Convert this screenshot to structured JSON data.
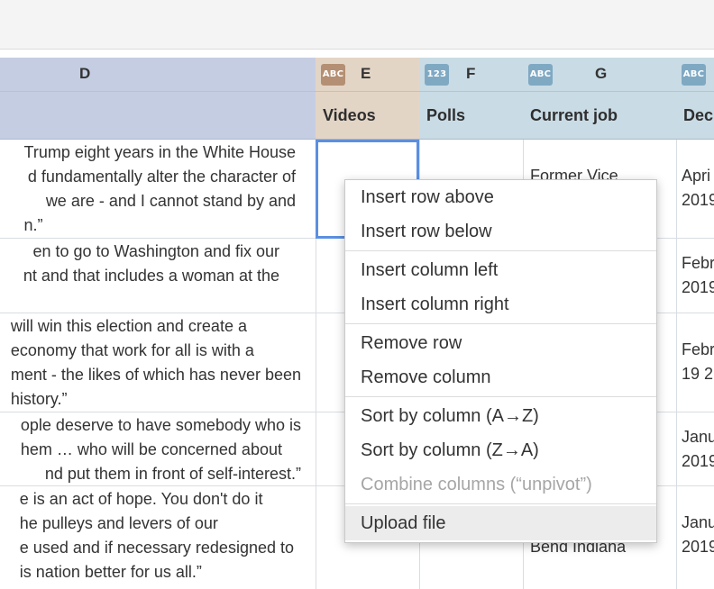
{
  "columns": {
    "D": {
      "letter": "D",
      "name": ""
    },
    "E": {
      "letter": "E",
      "name": "Videos",
      "type": "ABC"
    },
    "F": {
      "letter": "F",
      "name": "Polls",
      "type": "123"
    },
    "G": {
      "letter": "G",
      "name": "Current job",
      "type": "ABC"
    },
    "H": {
      "letter": "",
      "name": "Dec",
      "type": "ABC"
    }
  },
  "rows": [
    {
      "quote": [
        "Trump eight years in the White House",
        "d fundamentally alter the character of",
        "we are - and I cannot stand by and",
        "n.”"
      ],
      "job": "Former Vice",
      "date": [
        "Apri",
        "2019"
      ]
    },
    {
      "quote": [
        "en to go to Washington and fix our",
        "nt and that includes a woman at the"
      ],
      "job": "",
      "date": [
        "Febr",
        "2019"
      ]
    },
    {
      "quote": [
        "will win this election and create a",
        "economy that work for all is with a",
        "ment - the likes of which has never been",
        "history.”"
      ],
      "job": "",
      "date": [
        "Febr",
        "19 2"
      ]
    },
    {
      "quote": [
        "ople deserve to have somebody who is",
        "hem … who will be concerned about",
        "nd put them in front of self-interest.”"
      ],
      "job": "",
      "date": [
        "Janu",
        "2019"
      ]
    },
    {
      "quote": [
        "e is an act of hope. You don't do it",
        "he pulleys and levers of our",
        "e used and if necessary redesigned to",
        "is nation better for us all.”"
      ],
      "job": "Bend Indiana",
      "date": [
        "Janu",
        "2019"
      ]
    }
  ],
  "menu": {
    "insert_row_above": "Insert row above",
    "insert_row_below": "Insert row below",
    "insert_column_left": "Insert column left",
    "insert_column_right": "Insert column right",
    "remove_row": "Remove row",
    "remove_column": "Remove column",
    "sort_az": "Sort by column (A→Z)",
    "sort_za": "Sort by column (Z→A)",
    "combine_columns": "Combine columns (“unpivot”)",
    "upload_file": "Upload file"
  },
  "colors": {
    "header_d": "#c5cde3",
    "header_e": "#e3d5c6",
    "header_fgh": "#c9dbe5",
    "badge_abc_e": "#b48f73",
    "badge_blue": "#7fa9c3",
    "selection": "#5b8fe0"
  }
}
